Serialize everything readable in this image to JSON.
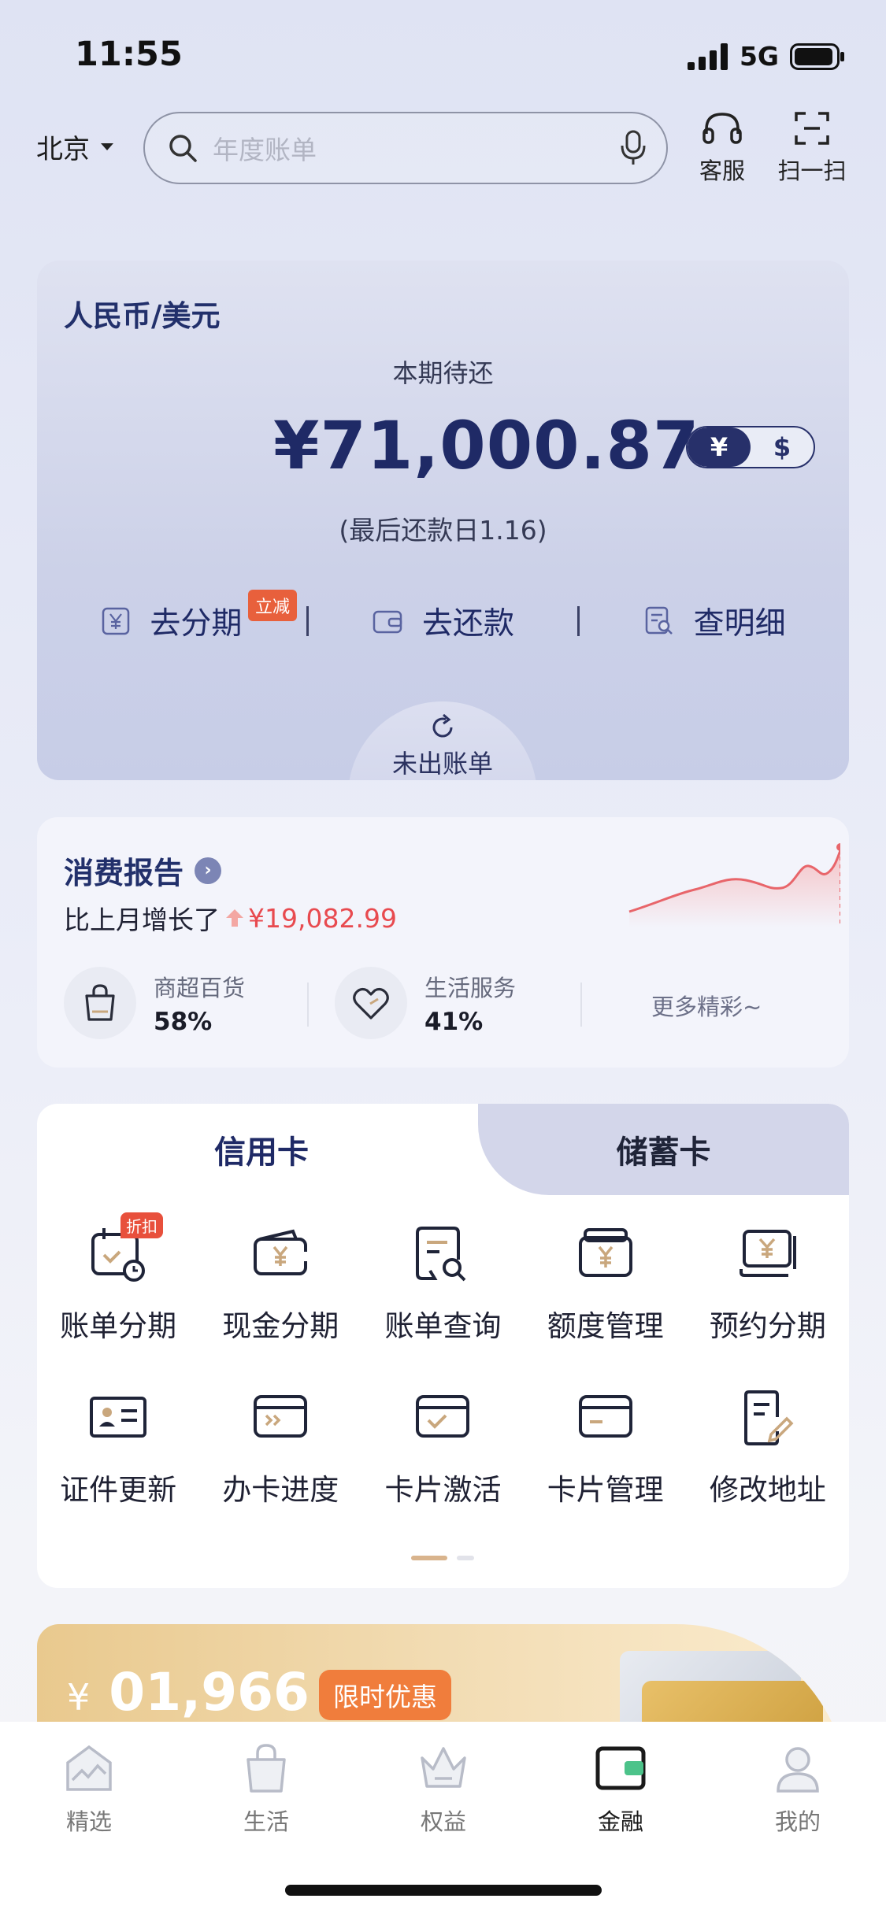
{
  "status_bar": {
    "time": "11:55",
    "network": "5G"
  },
  "top_bar": {
    "city": "北京",
    "search_placeholder": "年度账单",
    "service_label": "客服",
    "scan_label": "扫一扫"
  },
  "statement": {
    "currency_title": "人民币/美元",
    "period_label": "本期待还",
    "amount": "¥71,000.87",
    "toggle": {
      "cny": "¥",
      "usd": "$",
      "selected": "cny"
    },
    "due_text": "(最后还款日1.16)",
    "badge": "立减",
    "actions": [
      {
        "label": "去分期",
        "icon": "yen-square-icon"
      },
      {
        "label": "去还款",
        "icon": "wallet-icon"
      },
      {
        "label": "查明细",
        "icon": "document-search-icon"
      }
    ],
    "unbilled_label": "未出账单"
  },
  "report": {
    "title": "消费报告",
    "compare_text": "比上月增长了",
    "increase": "¥19,082.99",
    "categories": [
      {
        "name": "商超百货",
        "percent": "58%",
        "icon": "shopping-bag-icon"
      },
      {
        "name": "生活服务",
        "percent": "41%",
        "icon": "heart-icon"
      }
    ],
    "more": "更多精彩~"
  },
  "cards": {
    "tabs": [
      "信用卡",
      "储蓄卡"
    ],
    "active_tab": "信用卡",
    "services": [
      {
        "label": "账单分期",
        "badge": "折扣"
      },
      {
        "label": "现金分期"
      },
      {
        "label": "账单查询"
      },
      {
        "label": "额度管理"
      },
      {
        "label": "预约分期"
      },
      {
        "label": "证件更新"
      },
      {
        "label": "办卡进度"
      },
      {
        "label": "卡片激活"
      },
      {
        "label": "卡片管理"
      },
      {
        "label": "修改地址"
      }
    ]
  },
  "promo": {
    "currency": "¥",
    "amount": "01,966",
    "tag": "限时优惠"
  },
  "bottom_nav": {
    "items": [
      "精选",
      "生活",
      "权益",
      "金融",
      "我的"
    ],
    "active": "金融"
  },
  "colors": {
    "primary": "#1f2a66",
    "accent_red": "#e84a4f",
    "promo_orange": "#f07d3c",
    "gold": "#d9b48d"
  }
}
